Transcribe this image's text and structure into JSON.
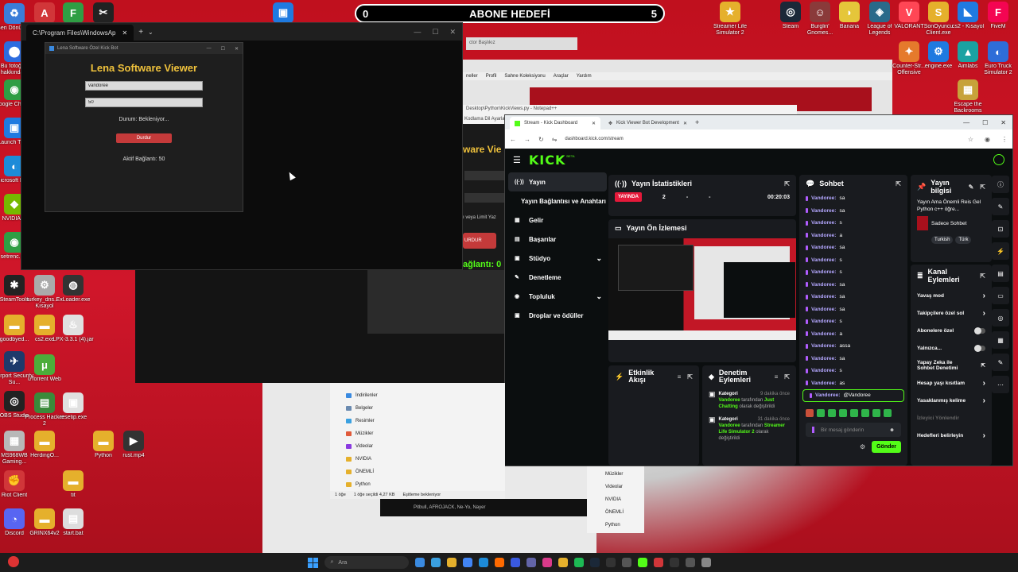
{
  "counter": {
    "left": "0",
    "title": "ABONE HEDEFİ",
    "right": "5"
  },
  "desktop_left_icons": [
    {
      "label": "Geri Dönüşü...",
      "color": "#3b7dd8",
      "glyph": "♻"
    },
    {
      "label": "Bu fotoğraf hakkında...",
      "color": "#2d6cdf",
      "glyph": "⬤"
    },
    {
      "label": "Google Chrome",
      "color": "#2f9e44",
      "glyph": "◉"
    },
    {
      "label": "Launch Tinify",
      "color": "#1f7ae0",
      "glyph": "▣"
    },
    {
      "label": "Microsoft Edge",
      "color": "#1d8bd8",
      "glyph": "◐"
    },
    {
      "label": "NVIDIA ...",
      "color": "#76b900",
      "glyph": "◆"
    },
    {
      "label": "setrenc.h...",
      "color": "#2f9e44",
      "glyph": "◉"
    },
    {
      "label": "SteamTools",
      "color": "#222",
      "glyph": "✱"
    },
    {
      "label": "goodbyed...",
      "color": "#e5b02c",
      "glyph": "▬"
    },
    {
      "label": "Airport Security Su...",
      "color": "#1e3a6b",
      "glyph": "✈"
    },
    {
      "label": "OBS Studio",
      "color": "#222",
      "glyph": "◎"
    },
    {
      "label": "MS968WB Gaming...",
      "color": "#b8b8b8",
      "glyph": "▦"
    },
    {
      "label": "Riot Client",
      "color": "#d13639",
      "glyph": "✊"
    },
    {
      "label": "Discord",
      "color": "#5865f2",
      "glyph": "◔"
    }
  ],
  "desktop_col2_icons": [
    {
      "label": "turkey_dns... - Kısayol",
      "color": "#aaa",
      "glyph": "⚙"
    },
    {
      "label": "cs2.exe",
      "color": "#e5b02c",
      "glyph": "▬"
    },
    {
      "label": "uTorrent Web",
      "color": "#4cad3a",
      "glyph": "μ"
    },
    {
      "label": "Process Hacker 2",
      "color": "#3a8a3a",
      "glyph": "▤"
    },
    {
      "label": "HerdingO...",
      "color": "#e5b02c",
      "glyph": "▬"
    },
    {
      "label": "GRINX64v2",
      "color": "#e5b02c",
      "glyph": "▬"
    }
  ],
  "desktop_col3_icons": [
    {
      "label": "ExLoader.exe",
      "color": "#333",
      "glyph": "◍"
    },
    {
      "label": "LPX-3.3.1 (4).jar",
      "color": "#e0e0e0",
      "glyph": "♨"
    },
    {
      "label": "resetip.exe",
      "color": "#e0e0e0",
      "glyph": "▣"
    },
    {
      "label": "Python",
      "color": "#e5b02c",
      "glyph": "▬"
    },
    {
      "label": "rust.mp4",
      "color": "#333",
      "glyph": "▶"
    },
    {
      "label": "tit",
      "color": "#e5b02c",
      "glyph": "▬"
    },
    {
      "label": "start.bat",
      "color": "#ddd",
      "glyph": "▤"
    }
  ],
  "desktop_top_icons": [
    {
      "label": "",
      "color": "#d13639",
      "glyph": "A"
    },
    {
      "label": "",
      "color": "#2f9e44",
      "glyph": "F"
    },
    {
      "label": "",
      "color": "#222",
      "glyph": "✂"
    },
    {
      "label": "",
      "color": "#1f7ae0",
      "glyph": "▣"
    }
  ],
  "desktop_right_icons": [
    {
      "label": "Streamer Life Simulator 2",
      "color": "#e5b02c",
      "glyph": "★"
    },
    {
      "label": "Steam",
      "color": "#1b2838",
      "glyph": "◎"
    },
    {
      "label": "Burglin' Gnomes...",
      "color": "#8a3a3a",
      "glyph": "☺"
    },
    {
      "label": "Banana",
      "color": "#e5c63a",
      "glyph": "◗"
    },
    {
      "label": "League of Legends",
      "color": "#2a6a8a",
      "glyph": "◈"
    },
    {
      "label": "VALORANT",
      "color": "#ff4655",
      "glyph": "V"
    },
    {
      "label": "SonOyuncu Client.exe",
      "color": "#e5b02c",
      "glyph": "S"
    },
    {
      "label": "cs2 - Kısayol",
      "color": "#1f7ae0",
      "glyph": "◣"
    },
    {
      "label": "FiveM",
      "color": "#f40552",
      "glyph": "F"
    },
    {
      "label": "Counter-Str... Offensive",
      "color": "#e57a2c",
      "glyph": "✦"
    },
    {
      "label": "engine.exe",
      "color": "#1f7ae0",
      "glyph": "⚙"
    },
    {
      "label": "Aimlabs",
      "color": "#1aa2a2",
      "glyph": "▲"
    },
    {
      "label": "Euro Truck Simulator 2",
      "color": "#2e6dd8",
      "glyph": "◐"
    },
    {
      "label": "Escape the Backrooms",
      "color": "#c7a23a",
      "glyph": "▦"
    }
  ],
  "terminal": {
    "tab_title": "C:\\Program Files\\WindowsAp",
    "new_tab": "+",
    "dropdown": "⌄"
  },
  "lena": {
    "window_title": "Lena Software Özel Kick Bot",
    "heading": "Lena Software Viewer",
    "username_value": "vandoree",
    "count_value": "50",
    "status": "Durum: Bekleniyor...",
    "stop_button": "Durdur",
    "active_connections": "Aktif Bağlantı: 50"
  },
  "partial_texts": {
    "viewer": "ware Vie",
    "note": "ı veya Limit Yaz",
    "stop": "URDUR",
    "conn": "ağlantı: 0"
  },
  "behind_window": {
    "tab": "ctor Başlıkız",
    "menu": [
      "neller",
      "Profil",
      "Sahne Koleksiyonu",
      "Araçlar",
      "Yardım"
    ],
    "path": "Desktop\\Python\\KickViews.py - Notepad++",
    "menu2": "Kodlama  Dil  Ayarlar  Araçlar"
  },
  "browser": {
    "tabs": [
      {
        "title": "Stream - Kick Dashboard",
        "active": true
      },
      {
        "title": "Kick Viewer Bot Development",
        "active": false
      }
    ],
    "url": "dashboard.kick.com/stream"
  },
  "kick": {
    "logo": "KICK",
    "logo_beta": "BETA",
    "sidebar": [
      {
        "icon": "stream-icon",
        "glyph": "((·))",
        "label": "Yayın",
        "active": true,
        "caret": false
      },
      {
        "icon": "",
        "glyph": "",
        "label": "Yayın Bağlantısı ve Anahtarı",
        "active": false,
        "caret": false
      },
      {
        "icon": "revenue-icon",
        "glyph": "▦",
        "label": "Gelir",
        "active": false,
        "caret": false
      },
      {
        "icon": "achievements-icon",
        "glyph": "▤",
        "label": "Başarılar",
        "active": false,
        "caret": false
      },
      {
        "icon": "studio-icon",
        "glyph": "▣",
        "label": "Stüdyo",
        "active": false,
        "caret": true
      },
      {
        "icon": "moderation-icon",
        "glyph": "✎",
        "label": "Denetleme",
        "active": false,
        "caret": false
      },
      {
        "icon": "community-icon",
        "glyph": "◉",
        "label": "Topluluk",
        "active": false,
        "caret": true
      },
      {
        "icon": "drops-icon",
        "glyph": "▣",
        "label": "Droplar ve ödüller",
        "active": false,
        "caret": false
      }
    ],
    "stats": {
      "title": "Yayın İstatistikleri",
      "live": "YAYINDA",
      "viewers": "2",
      "v2": "-",
      "v3": "-",
      "time": "00:20:03"
    },
    "preview": {
      "title": "Yayın Ön İzlemesi"
    },
    "activity": {
      "title": "Etkinlik Akışı"
    },
    "mod_actions": {
      "title": "Denetim Eylemleri",
      "items": [
        {
          "label": "Kategori",
          "time": "9 dakika önce",
          "user": "Vandoree",
          "mid": " tarafından ",
          "target": "Just Chatting",
          "suffix": " olarak değiştirildi"
        },
        {
          "label": "Kategori",
          "time": "31 dakika önce",
          "user": "Vandoree",
          "mid": " tarafından ",
          "target": "Streamer Life Simulator 2",
          "suffix": " olarak değiştirildi"
        }
      ]
    },
    "chat": {
      "title": "Sohbet",
      "messages": [
        {
          "u": "Vandoree:",
          "m": "sa"
        },
        {
          "u": "Vandoree:",
          "m": "sa"
        },
        {
          "u": "Vandoree:",
          "m": "s"
        },
        {
          "u": "Vandoree:",
          "m": "a"
        },
        {
          "u": "Vandoree:",
          "m": "sa"
        },
        {
          "u": "Vandoree:",
          "m": "s"
        },
        {
          "u": "Vandoree:",
          "m": "s"
        },
        {
          "u": "Vandoree:",
          "m": "sa"
        },
        {
          "u": "Vandoree:",
          "m": "sa"
        },
        {
          "u": "Vandoree:",
          "m": "sa"
        },
        {
          "u": "Vandoree:",
          "m": "s"
        },
        {
          "u": "Vandoree:",
          "m": "a"
        },
        {
          "u": "Vandoree:",
          "m": "assa"
        },
        {
          "u": "Vandoree:",
          "m": "sa"
        },
        {
          "u": "Vandoree:",
          "m": "s"
        },
        {
          "u": "Vandoree:",
          "m": "as"
        },
        {
          "u": "Vandoree:",
          "m": "@Vandoree"
        }
      ],
      "placeholder": "Bir mesaj gönderin",
      "send": "Gönder"
    },
    "stream_info": {
      "title": "Yayın bilgisi",
      "stream_title": "Yayın Ama Önemli Reis Gel Python c++ öğre...",
      "category": "Sadece Sohbet",
      "tags": [
        "Turkish",
        "Türk"
      ]
    },
    "channel_actions": {
      "title": "Kanal Eylemleri",
      "rows": [
        {
          "label": "Yavaş mod",
          "ctl": "arrow"
        },
        {
          "label": "Takipçilere özel sol",
          "ctl": "arrow"
        },
        {
          "label": "Abonelere özel",
          "ctl": "toggle"
        },
        {
          "label": "Yalnızca...",
          "ctl": "toggle"
        },
        {
          "label": "Yapay Zeka ile Sohbet Denetimi",
          "ctl": "ext"
        },
        {
          "label": "Hesap yaşı kısıtlam",
          "ctl": "arrow"
        },
        {
          "label": "Yasaklanmış kelime",
          "ctl": "arrow"
        },
        {
          "label": "İzleyici Yönlendir",
          "ctl": "none"
        },
        {
          "label": "Hedefleri belirleyin",
          "ctl": "arrow"
        }
      ]
    }
  },
  "explorer": {
    "items": [
      {
        "label": "İndirilenler",
        "color": "#3a8ae0"
      },
      {
        "label": "Belgeler",
        "color": "#6a8ab0"
      },
      {
        "label": "Resimler",
        "color": "#3aa0e0"
      },
      {
        "label": "Müzikler",
        "color": "#e05a3a"
      },
      {
        "label": "Videolar",
        "color": "#8a3ae0"
      },
      {
        "label": "NVIDIA",
        "color": "#e5b02c"
      },
      {
        "label": "ÖNEMLİ",
        "color": "#e5b02c"
      },
      {
        "label": "Python",
        "color": "#e5b02c"
      }
    ],
    "status": [
      "1 öğe",
      "1 öğe seçildi  4,27 KB",
      "Eşitleme bekleniyor"
    ]
  },
  "explorer2": {
    "items": [
      {
        "label": "Müzikler",
        "color": "#e05a3a"
      },
      {
        "label": "Videolar",
        "color": "#8a3ae0"
      },
      {
        "label": "NVIDIA",
        "color": "#e5b02c"
      },
      {
        "label": "ÖNEMLİ",
        "color": "#e5b02c"
      },
      {
        "label": "Python",
        "color": "#e5b02c"
      }
    ]
  },
  "media_strip": "Pitbull, AFROJACK, Ne-Yo, Nayer",
  "taskbar": {
    "search_placeholder": "Ara",
    "apps": [
      "#3a8ae0",
      "#3aa0e0",
      "#e5b02c",
      "#4285f4",
      "#1d8bd8",
      "#ff6a00",
      "#3a5ae0",
      "#6264a7",
      "#d93a8a",
      "#e5b02c",
      "#1db954",
      "#1b2838",
      "#333",
      "#555",
      "#53fc18",
      "#d13639",
      "#333",
      "#555",
      "#888"
    ]
  }
}
